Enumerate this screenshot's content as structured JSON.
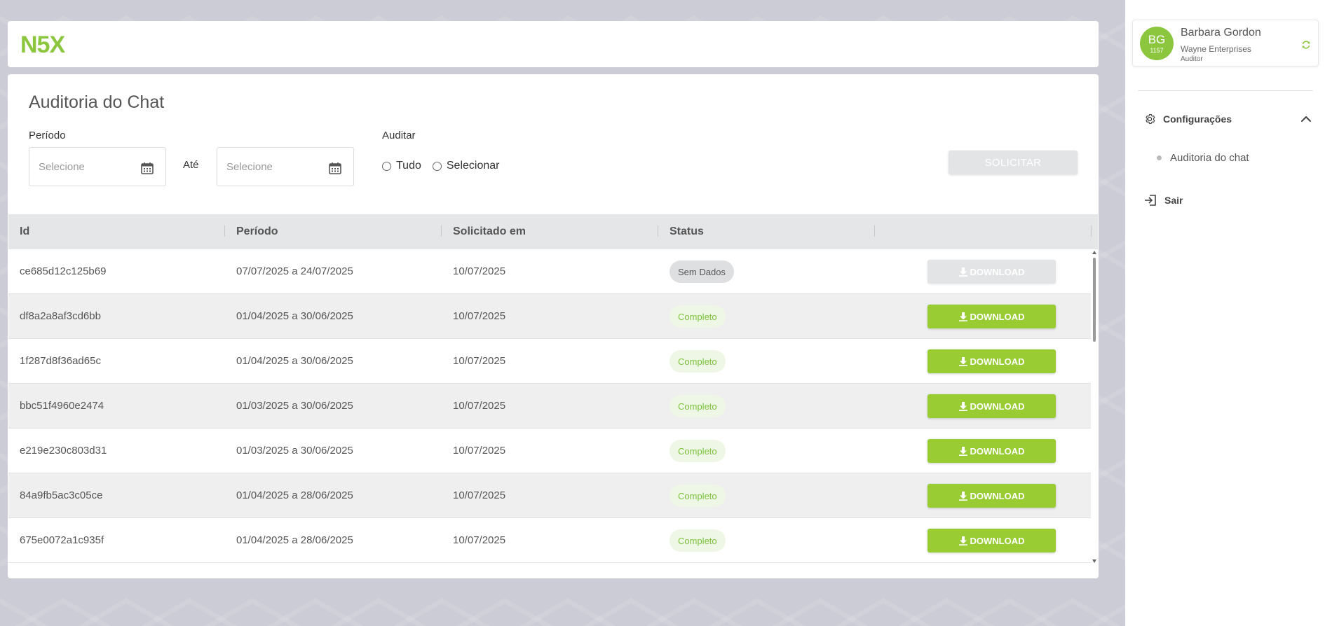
{
  "brand": {
    "logo_text": "N5X",
    "accent": "#8cc63f"
  },
  "page": {
    "title": "Auditoria do Chat",
    "periodo_label": "Período",
    "ate_label": "Até",
    "date_from_placeholder": "Selecione",
    "date_to_placeholder": "Selecione",
    "auditar_label": "Auditar",
    "radio_tudo": "Tudo",
    "radio_selecionar": "Selecionar",
    "solicitar_button": "SOLICITAR"
  },
  "table": {
    "columns": [
      "Id",
      "Período",
      "Solicitado em",
      "Status"
    ],
    "download_label": "DOWNLOAD",
    "rows": [
      {
        "id": "ce685d12c125b69",
        "periodo": "07/07/2025 a 24/07/2025",
        "solicitado": "10/07/2025",
        "status": "Sem Dados",
        "download_enabled": false
      },
      {
        "id": "df8a2a8af3cd6bb",
        "periodo": "01/04/2025 a 30/06/2025",
        "solicitado": "10/07/2025",
        "status": "Completo",
        "download_enabled": true
      },
      {
        "id": "1f287d8f36ad65c",
        "periodo": "01/04/2025 a 30/06/2025",
        "solicitado": "10/07/2025",
        "status": "Completo",
        "download_enabled": true
      },
      {
        "id": "bbc51f4960e2474",
        "periodo": "01/03/2025 a 30/06/2025",
        "solicitado": "10/07/2025",
        "status": "Completo",
        "download_enabled": true
      },
      {
        "id": "e219e230c803d31",
        "periodo": "01/03/2025 a 30/06/2025",
        "solicitado": "10/07/2025",
        "status": "Completo",
        "download_enabled": true
      },
      {
        "id": "84a9fb5ac3c05ce",
        "periodo": "01/04/2025 a 28/06/2025",
        "solicitado": "10/07/2025",
        "status": "Completo",
        "download_enabled": true
      },
      {
        "id": "675e0072a1c935f",
        "periodo": "01/04/2025 a 28/06/2025",
        "solicitado": "10/07/2025",
        "status": "Completo",
        "download_enabled": true
      }
    ]
  },
  "user": {
    "initials": "BG",
    "number": "1157",
    "name": "Barbara Gordon",
    "company": "Wayne Enterprises",
    "role": "Auditor"
  },
  "sidebar": {
    "config_label": "Configurações",
    "sub_items": [
      "Auditoria do chat"
    ],
    "logout_label": "Sair"
  }
}
